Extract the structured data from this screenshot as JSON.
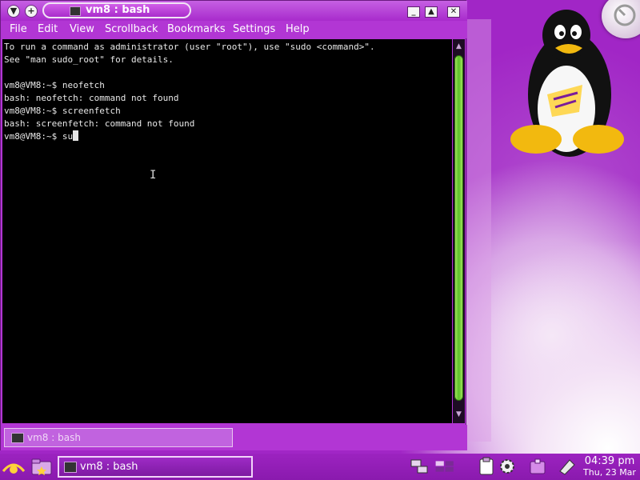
{
  "window": {
    "title": "vm8 : bash",
    "controls": {
      "shade": "▼",
      "pin": "+",
      "minimize": "_",
      "maximize": "▲",
      "close": "✕"
    }
  },
  "menubar": {
    "items": [
      "File",
      "Edit",
      "View",
      "Scrollback",
      "Bookmarks",
      "Settings",
      "Help"
    ]
  },
  "terminal": {
    "lines": [
      "To run a command as administrator (user \"root\"), use \"sudo <command>\".",
      "See \"man sudo_root\" for details.",
      "",
      "vm8@VM8:~$ neofetch",
      "bash: neofetch: command not found",
      "vm8@VM8:~$ screenfetch",
      "bash: screenfetch: command not found"
    ],
    "prompt": "vm8@VM8:~$ ",
    "current_input": "su"
  },
  "tabbar": {
    "tab_label": "vm8 : bash"
  },
  "taskbar": {
    "task_label": "vm8 : bash",
    "clock_time": "04:39 pm",
    "clock_date": "Thu, 23 Mar"
  },
  "icons": {
    "kmenu": "hannah-montana-logo-icon",
    "file_manager": "folder-icon",
    "tray": [
      "network-icon",
      "pager-icon",
      "clipboard-icon",
      "settings-gear-icon",
      "package-icon",
      "removable-media-icon"
    ]
  },
  "colors": {
    "window_purple": "#b236d4",
    "terminal_bg": "#000000",
    "terminal_fg": "#e8e8e8",
    "scroll_thumb": "#5cc02b",
    "panel": "#9c23c0"
  }
}
